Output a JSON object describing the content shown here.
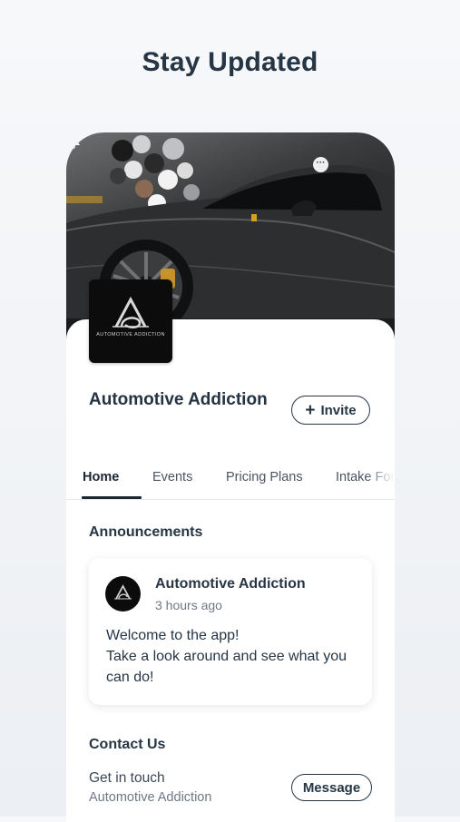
{
  "headline": "Stay Updated",
  "profile": {
    "name": "Automotive Addiction",
    "logo_text": "AUTOMOTIVE ADDICTION",
    "invite_label": "Invite"
  },
  "tabs": [
    {
      "label": "Home",
      "active": true
    },
    {
      "label": "Events",
      "active": false
    },
    {
      "label": "Pricing Plans",
      "active": false
    },
    {
      "label": "Intake For",
      "active": false
    }
  ],
  "announcements": {
    "heading": "Announcements",
    "post": {
      "author": "Automotive Addiction",
      "time": "3 hours ago",
      "line1": "Welcome to the app!",
      "line2": "Take a look around and see what you can do!"
    }
  },
  "contact": {
    "heading": "Contact Us",
    "prompt": "Get in touch",
    "business": "Automotive Addiction",
    "message_label": "Message"
  },
  "icons": {
    "more": "more-icon",
    "bell": "bell-icon",
    "plus": "plus-icon"
  }
}
